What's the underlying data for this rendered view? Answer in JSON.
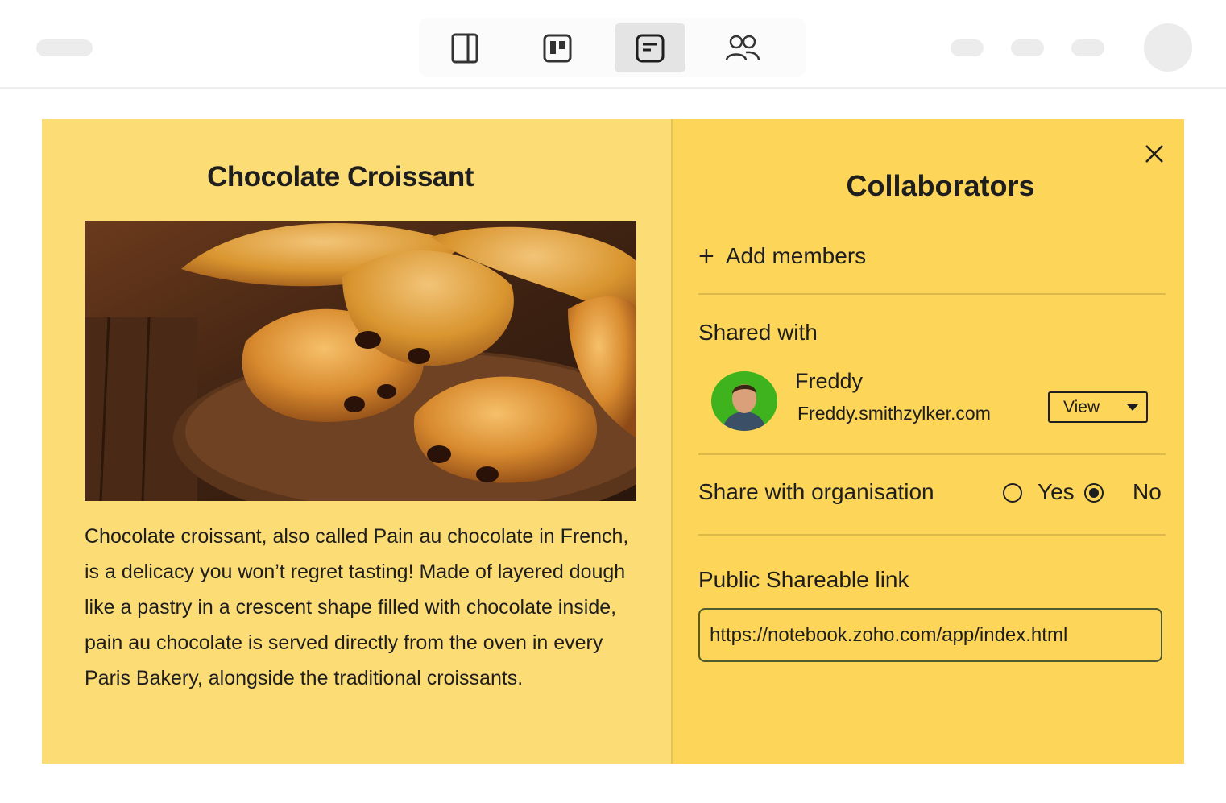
{
  "colors": {
    "note_background": "#fcdc75",
    "panel_background": "#fdd659",
    "toolbar_active": "#e4e4e4",
    "text": "#1e1e1e"
  },
  "toolbar": {
    "tools": [
      {
        "icon": "sidebar-panel-icon",
        "active": false
      },
      {
        "icon": "board-view-icon",
        "active": false
      },
      {
        "icon": "note-card-icon",
        "active": true
      },
      {
        "icon": "collaborators-icon",
        "active": false
      }
    ]
  },
  "note": {
    "title": "Chocolate Croissant",
    "image_icon": "croissant-photo",
    "body": "Chocolate croissant, also called Pain au chocolate in French, is a delicacy you won’t regret tasting! Made of layered dough like a pastry in a crescent shape filled with chocolate inside, pain au chocolate is served directly from the oven in every Paris Bakery, alongside the traditional croissants."
  },
  "collaborators": {
    "title": "Collaborators",
    "add_members": "Add members",
    "shared_with_label": "Shared with",
    "members": [
      {
        "name": "Freddy",
        "email": "Freddy.smithzylker.com",
        "permission": "View"
      }
    ],
    "share_org_label": "Share with organisation",
    "share_org_options": [
      "Yes",
      "No"
    ],
    "share_org_selected": "No",
    "public_link_label": "Public Shareable link",
    "public_link_value": "https://notebook.zoho.com/app/index.html"
  }
}
